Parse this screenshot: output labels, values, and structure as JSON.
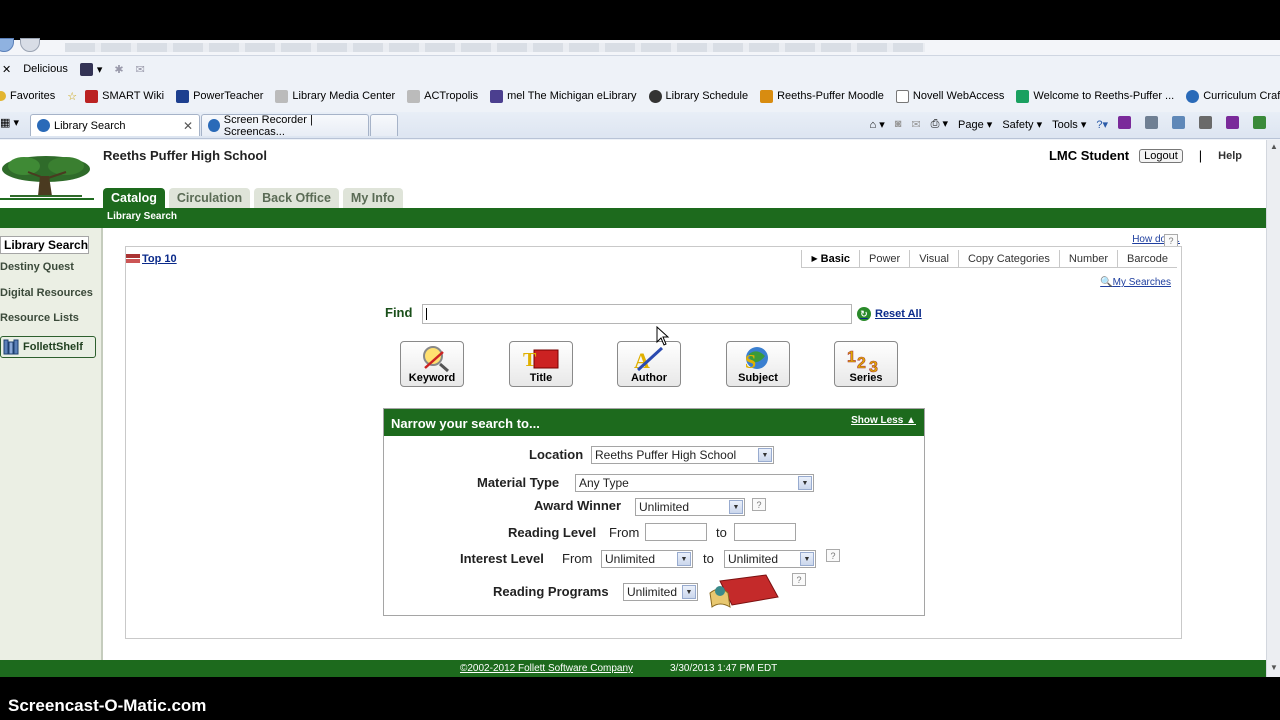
{
  "toolbar1": {
    "delicious": "Delicious"
  },
  "favorites_bar": {
    "label": "Favorites",
    "items": [
      {
        "label": "SMART Wiki"
      },
      {
        "label": "PowerTeacher"
      },
      {
        "label": "Library Media Center"
      },
      {
        "label": "ACTropolis"
      },
      {
        "label": "mel The Michigan eLibrary"
      },
      {
        "label": "Library Schedule"
      },
      {
        "label": "Reeths-Puffer Moodle"
      },
      {
        "label": "Novell WebAccess"
      },
      {
        "label": "Welcome to Reeths-Puffer ..."
      },
      {
        "label": "Curriculum Crafter"
      }
    ]
  },
  "browser_tabs": [
    {
      "label": "Library Search"
    },
    {
      "label": "Screen Recorder | Screencas..."
    }
  ],
  "command_bar": {
    "page": "Page",
    "safety": "Safety",
    "tools": "Tools"
  },
  "header": {
    "school": "Reeths Puffer High School",
    "user": "LMC Student",
    "logout": "Logout",
    "separator": "|",
    "help": "Help"
  },
  "app_tabs": [
    "Catalog",
    "Circulation",
    "Back Office",
    "My Info"
  ],
  "subnav": "Library Search",
  "sidebar": {
    "items": [
      "Library Search",
      "Destiny Quest",
      "Digital Resources",
      "Resource Lists"
    ],
    "follett": "FollettShelf"
  },
  "help_link": "How do I...",
  "qmark": "?",
  "top10": "Top 10",
  "search_modes": [
    "Basic",
    "Power",
    "Visual",
    "Copy Categories",
    "Number",
    "Barcode"
  ],
  "my_searches": "My Searches",
  "find": {
    "label": "Find",
    "value": "",
    "reset": "Reset All"
  },
  "search_buttons": [
    "Keyword",
    "Title",
    "Author",
    "Subject",
    "Series"
  ],
  "narrow": {
    "title": "Narrow your search to...",
    "show_less": "Show Less",
    "location": {
      "label": "Location",
      "value": "Reeths Puffer High School"
    },
    "material_type": {
      "label": "Material Type",
      "value": "Any Type"
    },
    "award_winner": {
      "label": "Award Winner",
      "value": "Unlimited"
    },
    "reading_level": {
      "label": "Reading Level",
      "from": "From",
      "to": "to"
    },
    "interest_level": {
      "label": "Interest Level",
      "from": "From",
      "from_value": "Unlimited",
      "to": "to",
      "to_value": "Unlimited"
    },
    "reading_programs": {
      "label": "Reading Programs",
      "value": "Unlimited"
    }
  },
  "footer": {
    "copyright": "©2002-2012  Follett Software Company",
    "datetime": "3/30/2013 1:47 PM EDT"
  },
  "watermark": "Screencast-O-Matic.com"
}
